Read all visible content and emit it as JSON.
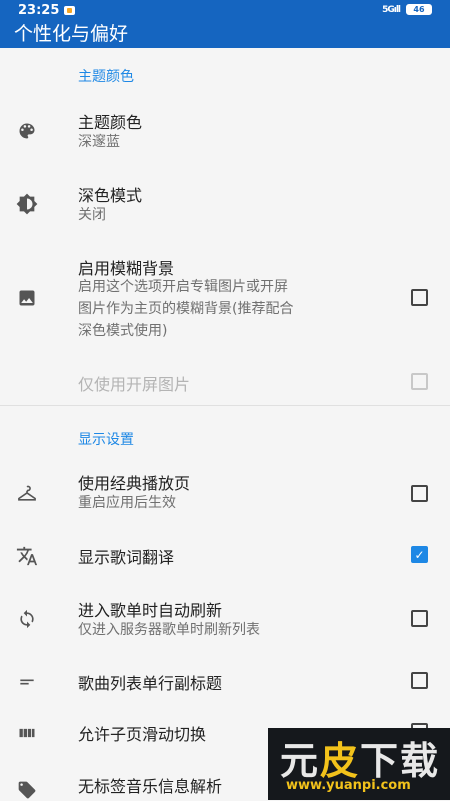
{
  "status": {
    "time": "23:25",
    "signal": "5G",
    "battery": "46"
  },
  "header": {
    "title": "个性化与偏好"
  },
  "sections": {
    "theme": {
      "header": "主题颜色",
      "theme_color": {
        "title": "主题颜色",
        "value": "深邃蓝",
        "icon": "palette-icon"
      },
      "dark_mode": {
        "title": "深色模式",
        "value": "关闭",
        "icon": "brightness-icon"
      },
      "blur_bg": {
        "title": "启用模糊背景",
        "desc_line1": "启用这个选项开启专辑图片或开屏",
        "desc_line2": "图片作为主页的模糊背景(推荐配合",
        "desc_line3": "深色模式使用)",
        "icon": "image-icon",
        "checked": false
      },
      "splash_only": {
        "title": "仅使用开屏图片",
        "checked": false,
        "disabled": true
      }
    },
    "display": {
      "header": "显示设置",
      "classic_player": {
        "title": "使用经典播放页",
        "desc": "重启应用后生效",
        "icon": "hanger-icon",
        "checked": false
      },
      "lyric_translate": {
        "title": "显示歌词翻译",
        "icon": "translate-icon",
        "checked": true
      },
      "auto_refresh": {
        "title": "进入歌单时自动刷新",
        "desc": "仅进入服务器歌单时刷新列表",
        "icon": "sync-icon",
        "checked": false
      },
      "single_line_subtitle": {
        "title": "歌曲列表单行副标题",
        "icon": "short-text-icon",
        "checked": false
      },
      "swipe_pages": {
        "title": "允许子页滑动切换",
        "icon": "view-week-icon",
        "checked": false
      },
      "untagged_parse": {
        "title": "无标签音乐信息解析",
        "icon": "tag-icon"
      }
    }
  },
  "watermark": {
    "text_a": "元",
    "text_b": "皮",
    "text_c": "下载",
    "url": "www.yuanpi.com"
  }
}
